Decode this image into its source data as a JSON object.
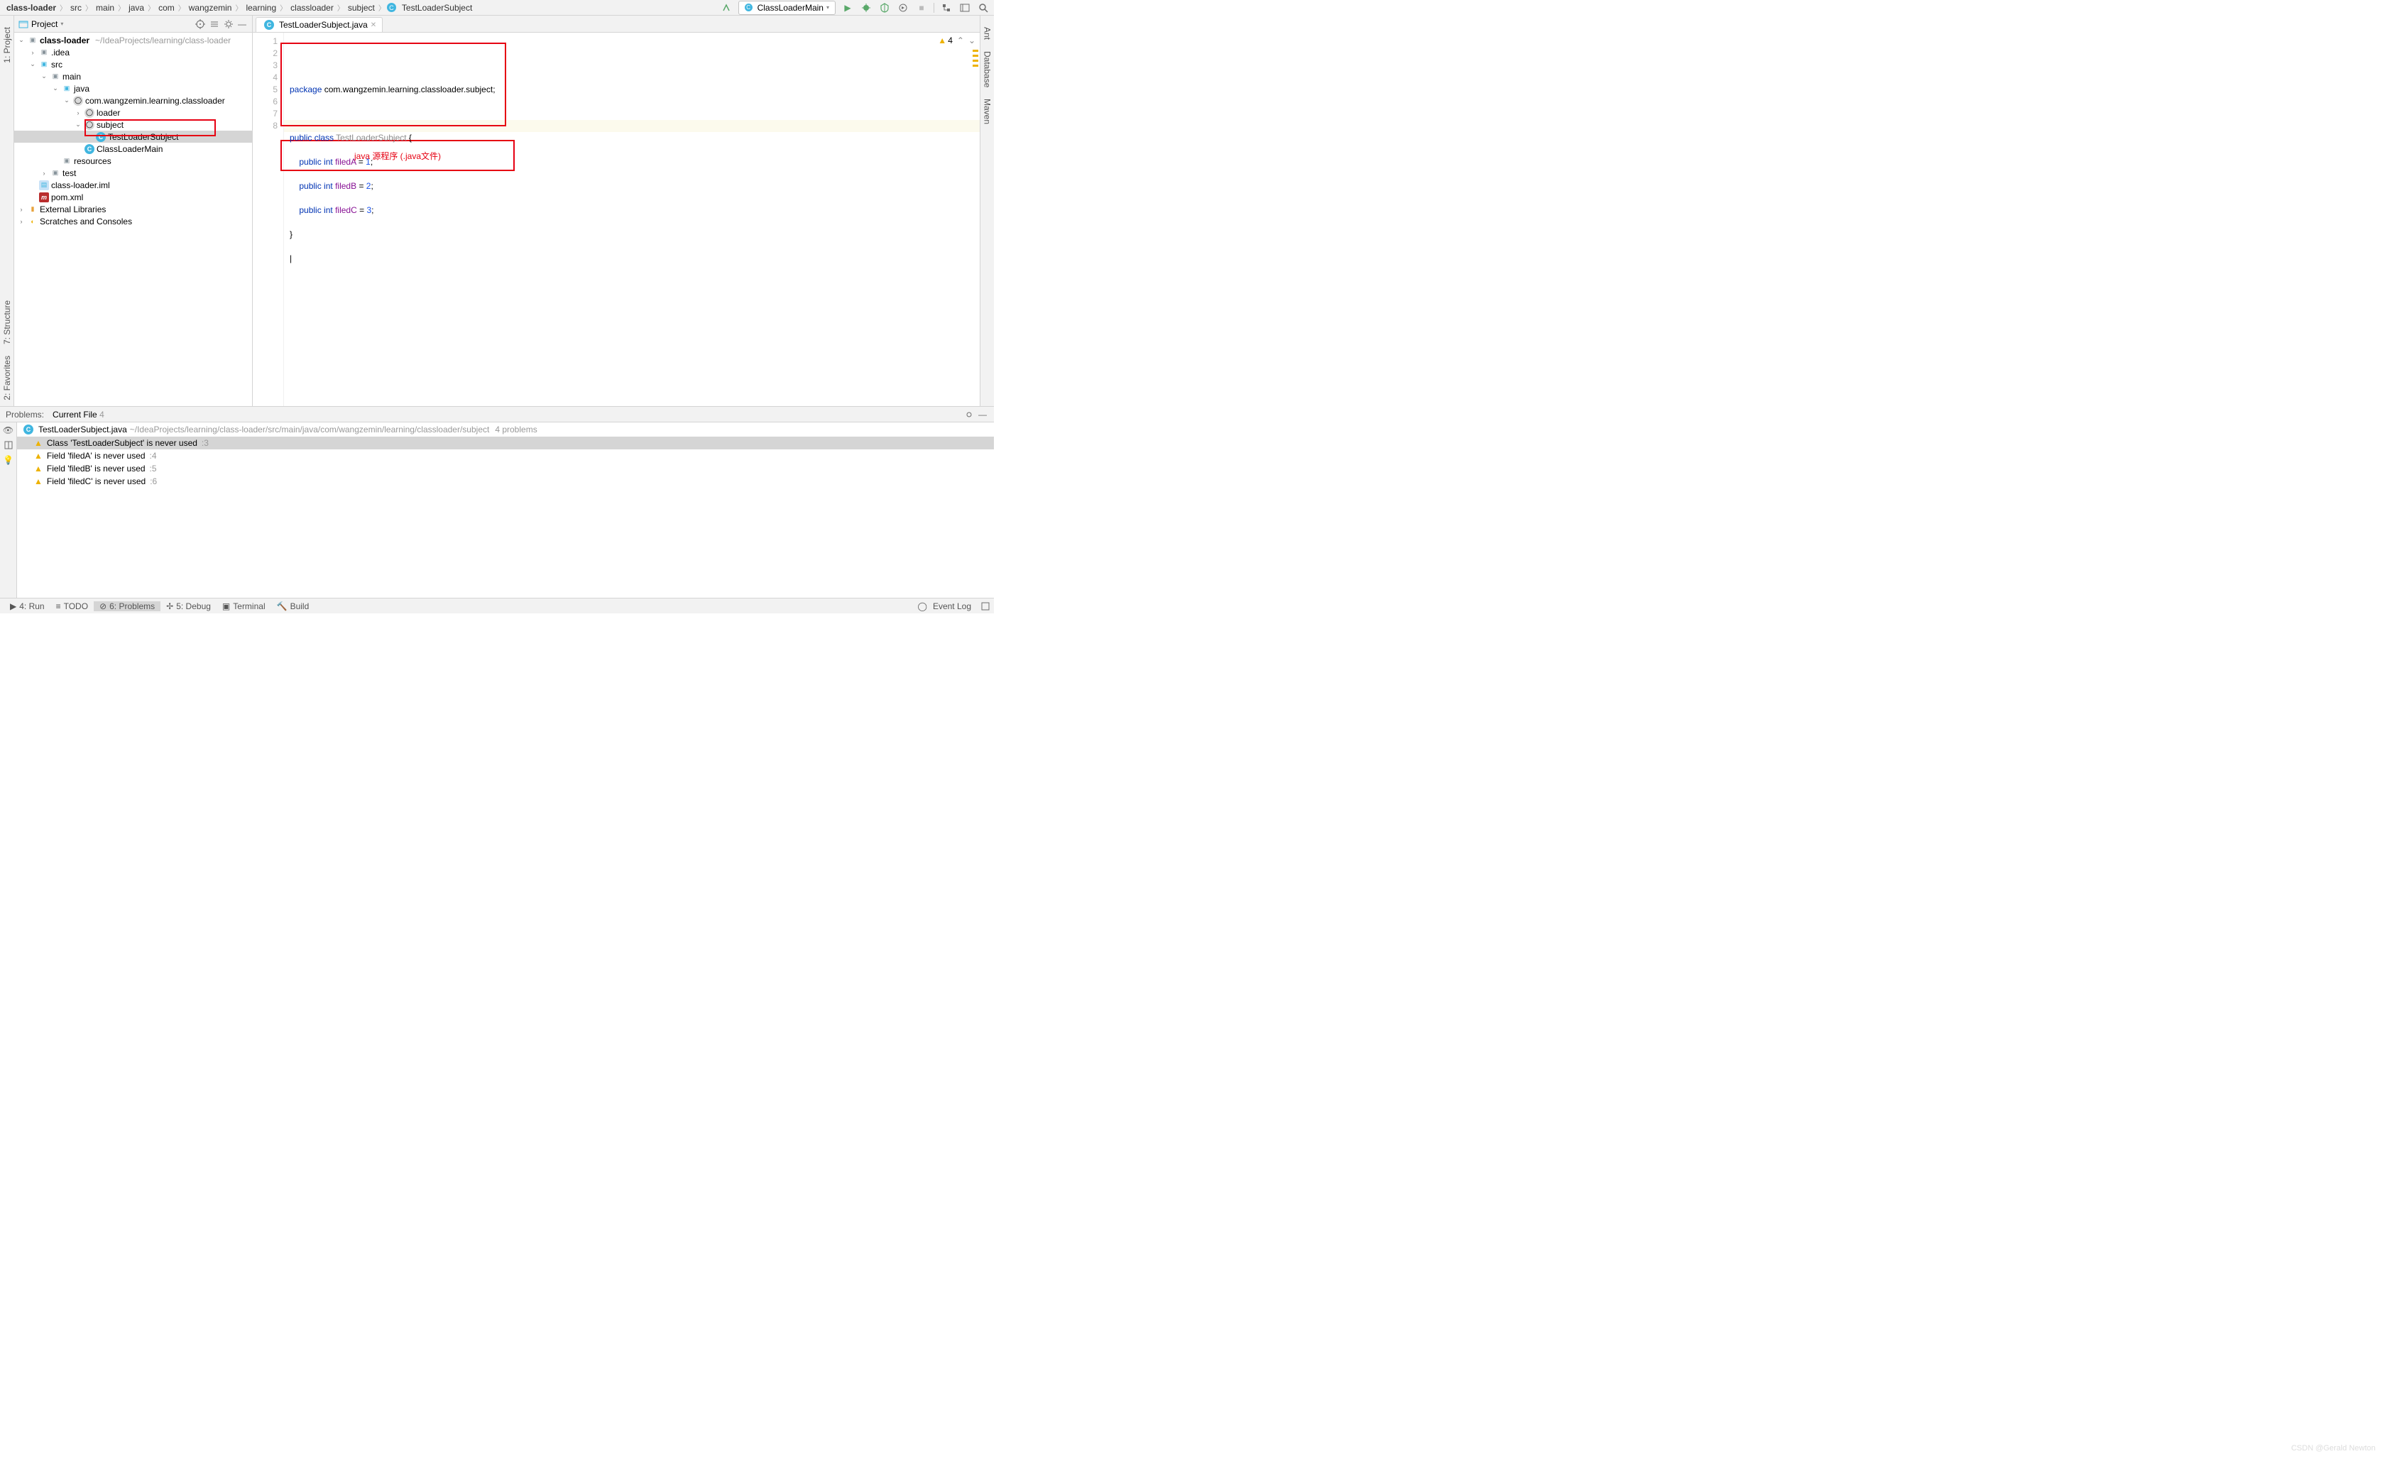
{
  "breadcrumb": [
    "class-loader",
    "src",
    "main",
    "java",
    "com",
    "wangzemin",
    "learning",
    "classloader",
    "subject",
    "TestLoaderSubject"
  ],
  "runConfig": "ClassLoaderMain",
  "sidebar": {
    "title": "Project",
    "root": {
      "name": "class-loader",
      "hint": "~/IdeaProjects/learning/class-loader"
    },
    "idea": ".idea",
    "src": "src",
    "main": "main",
    "java": "java",
    "pkg": "com.wangzemin.learning.classloader",
    "loader": "loader",
    "subject": "subject",
    "testLoader": "TestLoaderSubject",
    "classLoaderMain": "ClassLoaderMain",
    "resources": "resources",
    "test": "test",
    "iml": "class-loader.iml",
    "pom": "pom.xml",
    "extLib": "External Libraries",
    "scratches": "Scratches and Consoles"
  },
  "tab": {
    "name": "TestLoaderSubject.java"
  },
  "code": {
    "lines": [
      "1",
      "2",
      "3",
      "4",
      "5",
      "6",
      "7",
      "8"
    ],
    "pkg": "package",
    "pkgName": "com.wangzemin.learning.classloader.subject",
    "pub": "public",
    "cls": "class",
    "int": "int",
    "className": "TestLoaderSubject",
    "fA": "filedA",
    "fB": "filedB",
    "fC": "filedC",
    "v1": "1",
    "v2": "2",
    "v3": "3"
  },
  "annotation": "java 源程序 (.java文件)",
  "editorWarn": "4",
  "problems": {
    "tabProblems": "Problems:",
    "tabCurrent": "Current File",
    "currentCount": "4",
    "file": "TestLoaderSubject.java",
    "path": "~/IdeaProjects/learning/class-loader/src/main/java/com/wangzemin/learning/classloader/subject",
    "count": "4 problems",
    "items": [
      {
        "msg": "Class 'TestLoaderSubject' is never used",
        "loc": ":3"
      },
      {
        "msg": "Field 'filedA' is never used",
        "loc": ":4"
      },
      {
        "msg": "Field 'filedB' is never used",
        "loc": ":5"
      },
      {
        "msg": "Field 'filedC' is never used",
        "loc": ":6"
      }
    ]
  },
  "bottomTabs": {
    "run": "4: Run",
    "todo": "TODO",
    "problems": "6: Problems",
    "debug": "5: Debug",
    "terminal": "Terminal",
    "build": "Build",
    "eventLog": "Event Log"
  },
  "leftTabs": {
    "project": "1: Project",
    "structure": "7: Structure",
    "favorites": "2: Favorites"
  },
  "rightTabs": {
    "ant": "Ant",
    "database": "Database",
    "maven": "Maven"
  },
  "watermark": "CSDN @Gerald Newton"
}
